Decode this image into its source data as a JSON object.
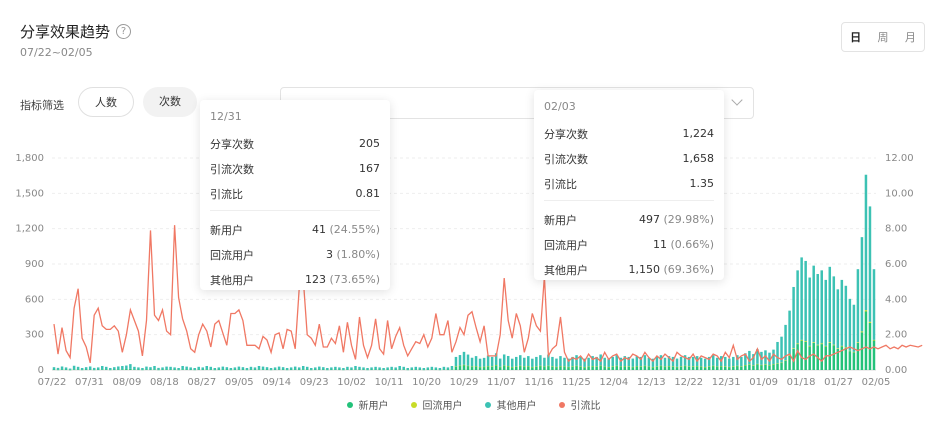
{
  "header": {
    "title": "分享效果趋势",
    "help_icon": "question-circle-icon",
    "date_range": "07/22~02/05"
  },
  "period": {
    "day": "日",
    "week": "周",
    "month": "月"
  },
  "filter": {
    "label": "指标筛选",
    "chip1": "人数",
    "chip2": "次数"
  },
  "tooltip1": {
    "date": "12/31",
    "rows": [
      {
        "label": "分享次数",
        "value": "205"
      },
      {
        "label": "引流次数",
        "value": "167"
      },
      {
        "label": "引流比",
        "value": "0.81"
      }
    ],
    "users": [
      {
        "label": "新用户",
        "value": "41",
        "pct": "(24.55%)"
      },
      {
        "label": "回流用户",
        "value": "3",
        "pct": "(1.80%)"
      },
      {
        "label": "其他用户",
        "value": "123",
        "pct": "(73.65%)"
      }
    ]
  },
  "tooltip2": {
    "date": "02/03",
    "rows": [
      {
        "label": "分享次数",
        "value": "1,224"
      },
      {
        "label": "引流次数",
        "value": "1,658"
      },
      {
        "label": "引流比",
        "value": "1.35"
      }
    ],
    "users": [
      {
        "label": "新用户",
        "value": "497",
        "pct": "(29.98%)"
      },
      {
        "label": "回流用户",
        "value": "11",
        "pct": "(0.66%)"
      },
      {
        "label": "其他用户",
        "value": "1,150",
        "pct": "(69.36%)"
      }
    ]
  },
  "chart_data": {
    "type": "bar",
    "x_ticks": [
      "07/22",
      "07/31",
      "08/09",
      "08/18",
      "08/27",
      "09/05",
      "09/14",
      "09/23",
      "10/02",
      "10/11",
      "10/20",
      "10/29",
      "11/07",
      "11/16",
      "11/25",
      "12/04",
      "12/13",
      "12/22",
      "12/31",
      "01/09",
      "01/18",
      "01/27",
      "02/05"
    ],
    "y_left_ticks": [
      "0",
      "300",
      "600",
      "900",
      "1,200",
      "1,500",
      "1,800"
    ],
    "y_left_range": [
      0,
      1800
    ],
    "y_right_ticks": [
      "0.00",
      "2.00",
      "4.00",
      "6.00",
      "8.00",
      "10.00",
      "12.00"
    ],
    "y_right_range": [
      0,
      12
    ],
    "legend": [
      "新用户",
      "回流用户",
      "其他用户",
      "引流比"
    ],
    "colors": {
      "new": "#23c27a",
      "returning": "#c8dc28",
      "other": "#3cc2b4",
      "ratio": "#f07864"
    },
    "series": [
      {
        "name": "新用户",
        "values": [
          4,
          3,
          5,
          4,
          2,
          6,
          5,
          3,
          4,
          5,
          3,
          4,
          6,
          5,
          3,
          4,
          5,
          6,
          8,
          10,
          5,
          4,
          3,
          5,
          4,
          6,
          3,
          4,
          5,
          5,
          4,
          3,
          6,
          5,
          4,
          3,
          5,
          4,
          6,
          5,
          3,
          4,
          5,
          4,
          3,
          4,
          5,
          4,
          3,
          5,
          4,
          6,
          5,
          4,
          3,
          4,
          5,
          4,
          3,
          4,
          5,
          4,
          6,
          5,
          3,
          4,
          5,
          4,
          3,
          4,
          5,
          4,
          3,
          5,
          4,
          6,
          5,
          4,
          3,
          4,
          5,
          4,
          3,
          4,
          5,
          4,
          6,
          5,
          3,
          4,
          5,
          4,
          3,
          4,
          5,
          4,
          3,
          5,
          4,
          6,
          30,
          36,
          42,
          35,
          28,
          32,
          25,
          27,
          32,
          30,
          40,
          26,
          36,
          33,
          25,
          30,
          35,
          28,
          32,
          25,
          30,
          35,
          28,
          35,
          30,
          26,
          32,
          28,
          26,
          30,
          35,
          30,
          25,
          28,
          32,
          30,
          36,
          28,
          25,
          30,
          35,
          28,
          32,
          30,
          26,
          32,
          30,
          35,
          28,
          25,
          30,
          35,
          28,
          32,
          30,
          26,
          30,
          35,
          30,
          30,
          32,
          28,
          25,
          30,
          35,
          28,
          32,
          30,
          26,
          30,
          35,
          30,
          40,
          45,
          38,
          50,
          42,
          45,
          40,
          48,
          55,
          60,
          80,
          120,
          180,
          220,
          250,
          240,
          200,
          230,
          210,
          220,
          200,
          230,
          210,
          180,
          200,
          190,
          160,
          150,
          230,
          320,
          497,
          400,
          250
        ]
      },
      {
        "name": "回流用户",
        "values": [
          0,
          0,
          0,
          0,
          0,
          0,
          0,
          0,
          0,
          0,
          0,
          0,
          0,
          0,
          0,
          0,
          0,
          0,
          0,
          0,
          0,
          0,
          0,
          0,
          0,
          0,
          0,
          0,
          0,
          0,
          0,
          0,
          0,
          0,
          0,
          0,
          0,
          0,
          0,
          0,
          0,
          0,
          0,
          0,
          0,
          0,
          0,
          0,
          0,
          0,
          0,
          0,
          0,
          0,
          0,
          0,
          0,
          0,
          0,
          0,
          0,
          0,
          0,
          0,
          0,
          0,
          0,
          0,
          0,
          0,
          0,
          0,
          0,
          0,
          0,
          0,
          0,
          0,
          0,
          0,
          0,
          0,
          0,
          0,
          0,
          0,
          0,
          0,
          0,
          0,
          0,
          0,
          0,
          0,
          0,
          0,
          0,
          0,
          0,
          0,
          1,
          1,
          2,
          1,
          1,
          1,
          1,
          1,
          1,
          1,
          2,
          1,
          1,
          1,
          1,
          1,
          1,
          1,
          1,
          1,
          1,
          1,
          1,
          1,
          1,
          1,
          1,
          1,
          1,
          1,
          1,
          1,
          1,
          1,
          1,
          1,
          1,
          1,
          1,
          1,
          1,
          1,
          1,
          1,
          1,
          1,
          1,
          1,
          1,
          1,
          1,
          1,
          1,
          1,
          1,
          1,
          1,
          1,
          1,
          1,
          1,
          1,
          1,
          1,
          1,
          1,
          1,
          1,
          1,
          1,
          1,
          1,
          2,
          2,
          2,
          2,
          2,
          2,
          2,
          2,
          3,
          3,
          3,
          4,
          5,
          6,
          6,
          6,
          5,
          6,
          5,
          6,
          5,
          6,
          5,
          5,
          5,
          5,
          4,
          4,
          6,
          8,
          11,
          9,
          6
        ]
      },
      {
        "name": "其他用户",
        "values": [
          20,
          15,
          25,
          18,
          10,
          30,
          22,
          14,
          20,
          25,
          15,
          18,
          28,
          22,
          14,
          20,
          25,
          28,
          30,
          40,
          22,
          18,
          14,
          24,
          20,
          28,
          15,
          18,
          24,
          22,
          18,
          14,
          28,
          24,
          18,
          14,
          22,
          18,
          28,
          22,
          14,
          18,
          24,
          20,
          14,
          18,
          24,
          20,
          14,
          22,
          18,
          28,
          24,
          20,
          14,
          18,
          24,
          20,
          14,
          18,
          24,
          18,
          28,
          22,
          14,
          18,
          24,
          20,
          14,
          18,
          22,
          18,
          14,
          22,
          18,
          28,
          22,
          18,
          14,
          18,
          22,
          18,
          14,
          18,
          22,
          18,
          28,
          22,
          14,
          18,
          22,
          18,
          14,
          18,
          22,
          18,
          14,
          22,
          18,
          28,
          80,
          90,
          110,
          95,
          75,
          85,
          70,
          75,
          90,
          80,
          100,
          70,
          95,
          85,
          70,
          80,
          90,
          75,
          85,
          70,
          80,
          90,
          75,
          95,
          80,
          70,
          85,
          75,
          70,
          80,
          90,
          80,
          70,
          75,
          85,
          80,
          95,
          75,
          70,
          80,
          90,
          75,
          85,
          80,
          70,
          85,
          80,
          90,
          75,
          70,
          80,
          90,
          75,
          85,
          80,
          70,
          80,
          90,
          80,
          80,
          85,
          75,
          70,
          80,
          90,
          75,
          85,
          80,
          70,
          80,
          90,
          80,
          100,
          115,
          95,
          125,
          110,
          120,
          105,
          123,
          180,
          220,
          300,
          380,
          520,
          620,
          700,
          680,
          580,
          650,
          600,
          620,
          560,
          640,
          580,
          500,
          560,
          520,
          440,
          400,
          620,
          800,
          1150,
          980,
          600
        ]
      },
      {
        "name": "引流比",
        "values": [
          2.6,
          0.9,
          2.4,
          1.1,
          0.7,
          3.5,
          4.6,
          1.8,
          1.3,
          0.4,
          3.1,
          3.5,
          2.5,
          2.3,
          2.3,
          2.5,
          2.2,
          1.0,
          2.0,
          3.4,
          2.8,
          2.2,
          0.8,
          2.8,
          7.9,
          3.1,
          2.8,
          3.4,
          2.2,
          2.0,
          8.2,
          4.1,
          2.9,
          2.2,
          1.2,
          1.0,
          2.0,
          2.6,
          2.2,
          1.3,
          2.6,
          2.8,
          2.1,
          1.4,
          3.2,
          3.2,
          3.4,
          2.8,
          1.4,
          1.4,
          1.4,
          1.2,
          1.9,
          1.7,
          1.0,
          2.0,
          2.1,
          1.2,
          2.3,
          2.2,
          1.2,
          4.6,
          5.2,
          2.0,
          1.8,
          1.4,
          2.6,
          1.3,
          1.3,
          1.8,
          1.5,
          2.5,
          1.0,
          2.7,
          1.4,
          0.6,
          3.0,
          1.4,
          0.7,
          1.4,
          2.9,
          1.2,
          0.9,
          2.8,
          1.2,
          1.9,
          2.4,
          1.4,
          0.8,
          1.2,
          1.6,
          1.5,
          2.0,
          1.3,
          1.8,
          3.2,
          2.0,
          2.0,
          2.8,
          1.0,
          1.6,
          2.4,
          2.0,
          3.1,
          3.3,
          2.4,
          1.6,
          2.5,
          0.8,
          0.8,
          0.8,
          2.0,
          5.2,
          2.8,
          1.8,
          3.2,
          2.5,
          1.0,
          1.8,
          3.2,
          2.5,
          2.2,
          5.3,
          0.8,
          1.2,
          1.4,
          3.0,
          1.0,
          0.5,
          0.7,
          0.6,
          0.8,
          0.5,
          0.9,
          0.6,
          0.7,
          0.5,
          1.0,
          0.6,
          0.8,
          0.9,
          0.5,
          0.7,
          0.6,
          0.9,
          0.8,
          0.6,
          1.0,
          0.7,
          0.5,
          0.8,
          0.6,
          0.9,
          0.7,
          0.5,
          1.0,
          0.8,
          0.7,
          0.6,
          0.9,
          0.5,
          0.8,
          0.7,
          0.6,
          0.9,
          0.8,
          0.5,
          1.0,
          0.7,
          1.4,
          0.6,
          0.8,
          0.9,
          0.5,
          0.7,
          1.2,
          0.6,
          0.8,
          0.5,
          0.9,
          0.7,
          0.6,
          0.8,
          0.9,
          0.5,
          1.1,
          0.7,
          0.6,
          0.8,
          0.9,
          0.7,
          0.5,
          0.8,
          0.81,
          0.9,
          1.0,
          1.1,
          1.2,
          1.3,
          1.2,
          1.1,
          1.2,
          1.3,
          1.2,
          1.3,
          1.2,
          1.3,
          1.4,
          1.2,
          1.3,
          1.2,
          1.4,
          1.3,
          1.4,
          1.35,
          1.3,
          1.4
        ]
      }
    ]
  }
}
